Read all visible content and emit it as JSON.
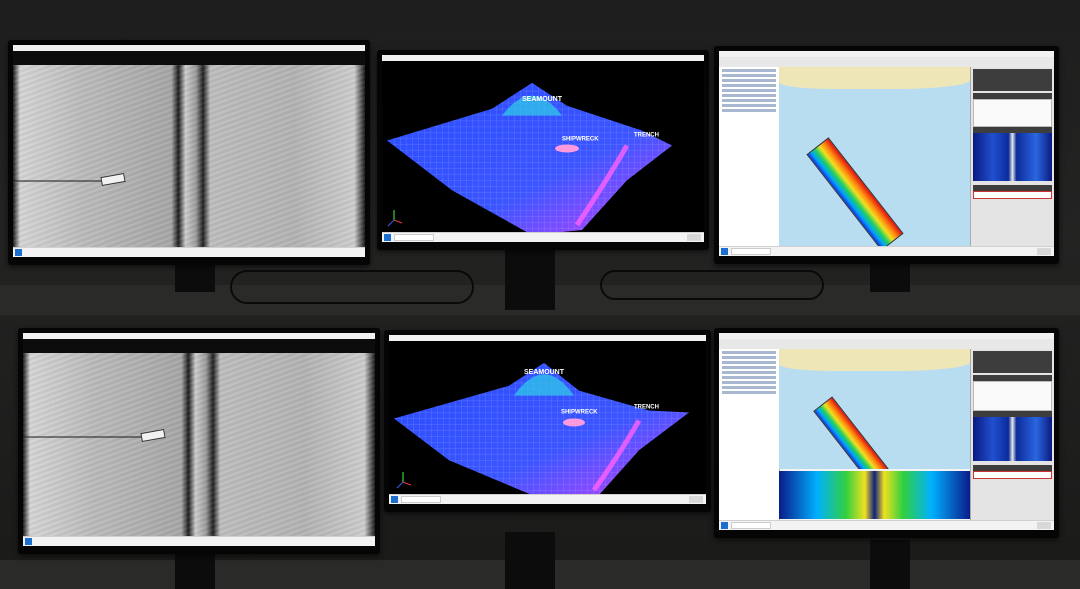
{
  "mesh_labels": {
    "peak": "SEAMOUNT",
    "wreck": "SHIPWRECK",
    "trench": "TRENCH"
  },
  "colors": {
    "mesh_blue": "#3a5cff",
    "mesh_magenta": "#e040ff",
    "swath_low": "#1530d8",
    "swath_high": "#e01010",
    "map_water": "#b9ddf0",
    "map_land": "#efe6b8"
  },
  "icons": [
    "windows-start-icon",
    "taskbar-search-icon",
    "axis-gizmo-icon"
  ]
}
